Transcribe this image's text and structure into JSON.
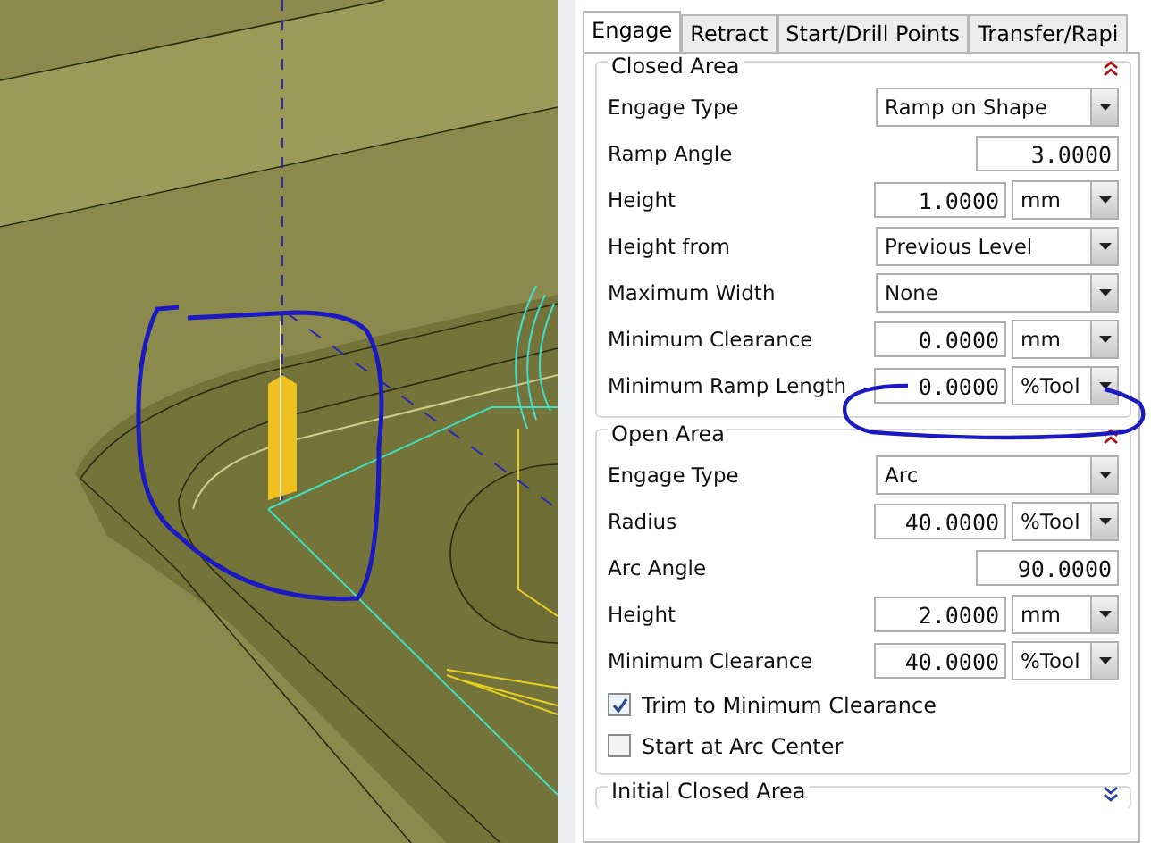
{
  "tabs": [
    {
      "label": "Engage",
      "selected": true
    },
    {
      "label": "Retract",
      "selected": false
    },
    {
      "label": "Start/Drill Points",
      "selected": false
    },
    {
      "label": "Transfer/Rapi",
      "selected": false
    }
  ],
  "groups": [
    {
      "title": "Closed Area",
      "expanded": true,
      "rows": [
        {
          "kind": "dropdown",
          "label": "Engage Type",
          "value": "Ramp on Shape"
        },
        {
          "kind": "number",
          "label": "Ramp Angle",
          "value": "3.0000"
        },
        {
          "kind": "number_unit",
          "label": "Height",
          "value": "1.0000",
          "unit": "mm"
        },
        {
          "kind": "dropdown",
          "label": "Height from",
          "value": "Previous Level"
        },
        {
          "kind": "dropdown",
          "label": "Maximum Width",
          "value": "None"
        },
        {
          "kind": "number_unit",
          "label": "Minimum Clearance",
          "value": "0.0000",
          "unit": "mm"
        },
        {
          "kind": "number_unit",
          "label": "Minimum Ramp Length",
          "value": "0.0000",
          "unit": "%Tool"
        }
      ]
    },
    {
      "title": "Open Area",
      "expanded": true,
      "rows": [
        {
          "kind": "dropdown",
          "label": "Engage Type",
          "value": "Arc"
        },
        {
          "kind": "number_unit",
          "label": "Radius",
          "value": "40.0000",
          "unit": "%Tool"
        },
        {
          "kind": "number",
          "label": "Arc Angle",
          "value": "90.0000"
        },
        {
          "kind": "number_unit",
          "label": "Height",
          "value": "2.0000",
          "unit": "mm"
        },
        {
          "kind": "number_unit",
          "label": "Minimum Clearance",
          "value": "40.0000",
          "unit": "%Tool"
        },
        {
          "kind": "checkbox",
          "label": "Trim to Minimum Clearance",
          "checked": true
        },
        {
          "kind": "checkbox",
          "label": "Start at Arc Center",
          "checked": false
        }
      ]
    },
    {
      "title": "Initial Closed Area",
      "expanded": false
    }
  ]
}
